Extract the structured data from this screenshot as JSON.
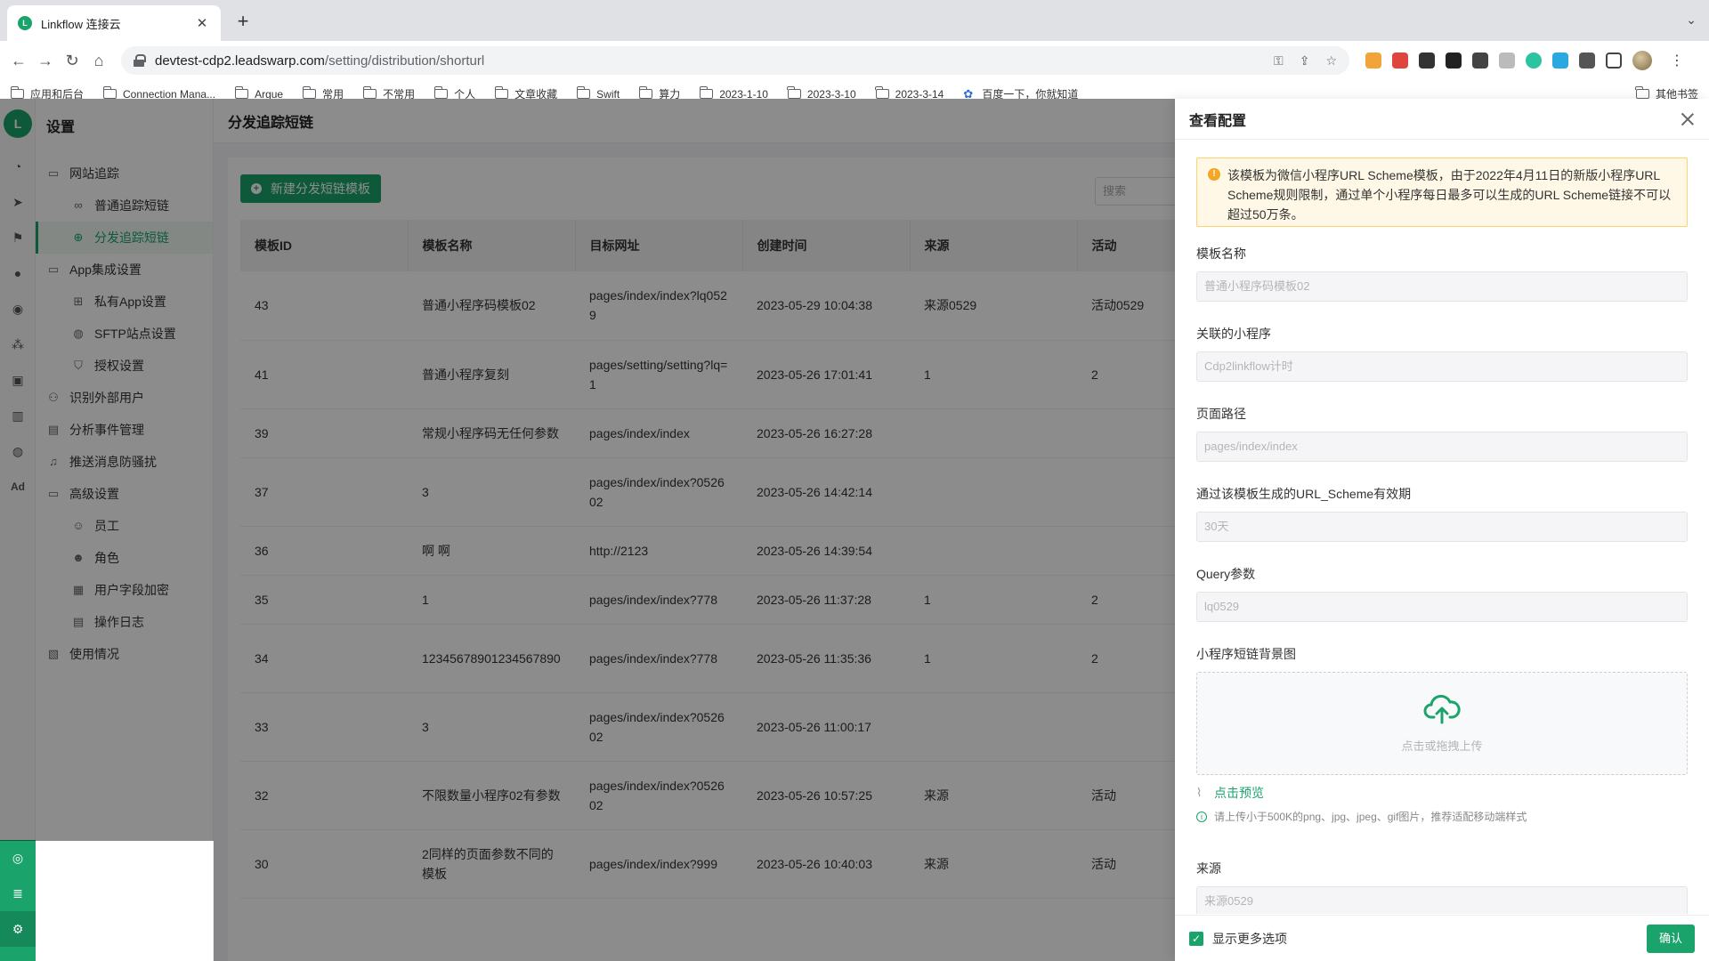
{
  "browser": {
    "tab_title": "Linkflow 连接云",
    "url_host": "devtest-cdp2.leadswarp.com",
    "url_path": "/setting/distribution/shorturl",
    "bookmarks": [
      "应用和后台",
      "Connection Mana...",
      "Argue",
      "常用",
      "不常用",
      "个人",
      "文章收藏",
      "Swift",
      "算力",
      "2023-1-10",
      "2023-3-10",
      "2023-3-14"
    ],
    "bookmark_baidu": "百度一下，你就知道",
    "bookmark_other": "其他书签"
  },
  "nav": {
    "title": "设置",
    "items": [
      {
        "label": "网站追踪",
        "icon": "folder-icon",
        "level": 1
      },
      {
        "label": "普通追踪短链",
        "icon": "link-icon",
        "level": 2
      },
      {
        "label": "分发追踪短链",
        "icon": "target-icon",
        "level": 2,
        "active": true
      },
      {
        "label": "App集成设置",
        "icon": "folder-icon",
        "level": 1
      },
      {
        "label": "私有App设置",
        "icon": "apps-icon",
        "level": 2
      },
      {
        "label": "SFTP站点设置",
        "icon": "globe-icon",
        "level": 2
      },
      {
        "label": "授权设置",
        "icon": "shield-icon",
        "level": 2
      },
      {
        "label": "识别外部用户",
        "icon": "user-search-icon",
        "level": 1
      },
      {
        "label": "分析事件管理",
        "icon": "event-icon",
        "level": 1
      },
      {
        "label": "推送消息防骚扰",
        "icon": "bell-off-icon",
        "level": 1
      },
      {
        "label": "高级设置",
        "icon": "folder-icon",
        "level": 1
      },
      {
        "label": "员工",
        "icon": "user-icon",
        "level": 2
      },
      {
        "label": "角色",
        "icon": "role-icon",
        "level": 2
      },
      {
        "label": "用户字段加密",
        "icon": "encrypt-icon",
        "level": 2
      },
      {
        "label": "操作日志",
        "icon": "log-icon",
        "level": 2
      },
      {
        "label": "使用情况",
        "icon": "usage-icon",
        "level": 1
      }
    ]
  },
  "main": {
    "page_title": "分发追踪短链",
    "new_button": "新建分发短链模板",
    "search_placeholder": "搜索",
    "columns": [
      "模板ID",
      "模板名称",
      "目标网址",
      "创建时间",
      "来源",
      "活动"
    ],
    "rows": [
      [
        "43",
        "普通小程序码模板02",
        "pages/index/index?lq0529",
        "2023-05-29 10:04:38",
        "来源0529",
        "活动0529"
      ],
      [
        "41",
        "普通小程序复刻",
        "pages/setting/setting?lq=1",
        "2023-05-26 17:01:41",
        "1",
        "2"
      ],
      [
        "39",
        "常规小程序码无任何参数",
        "pages/index/index",
        "2023-05-26 16:27:28",
        "",
        ""
      ],
      [
        "37",
        "3",
        "pages/index/index?052602",
        "2023-05-26 14:42:14",
        "",
        ""
      ],
      [
        "36",
        "啊 啊",
        "http://2123",
        "2023-05-26 14:39:54",
        "",
        ""
      ],
      [
        "35",
        "1",
        "pages/index/index?778",
        "2023-05-26 11:37:28",
        "1",
        "2"
      ],
      [
        "34",
        "12345678901234567890",
        "pages/index/index?778",
        "2023-05-26 11:35:36",
        "1",
        "2"
      ],
      [
        "33",
        "3",
        "pages/index/index?052602",
        "2023-05-26 11:00:17",
        "",
        ""
      ],
      [
        "32",
        "不限数量小程序02有参数",
        "pages/index/index?052602",
        "2023-05-26 10:57:25",
        "来源",
        "活动"
      ],
      [
        "30",
        "2同样的页面参数不同的模板",
        "pages/index/index?999",
        "2023-05-26 10:40:03",
        "来源",
        "活动"
      ]
    ]
  },
  "drawer": {
    "title": "查看配置",
    "warning": "该模板为微信小程序URL Scheme模板，由于2022年4月11日的新版小程序URL Scheme规则限制，通过单个小程序每日最多可以生成的URL Scheme链接不可以超过50万条。",
    "fields": [
      {
        "label": "模板名称",
        "value": "普通小程序码模板02"
      },
      {
        "label": "关联的小程序",
        "value": "Cdp2linkflow计时"
      },
      {
        "label": "页面路径",
        "value": "pages/index/index"
      },
      {
        "label": "通过该模板生成的URL_Scheme有效期",
        "value": "30天"
      },
      {
        "label": "Query参数",
        "value": "lq0529"
      }
    ],
    "bg_label": "小程序短链背景图",
    "upload_hint": "点击或拖拽上传",
    "preview": "点击预览",
    "upload_tip": "请上传小于500K的png、jpg、jpeg、gif图片，推荐适配移动端样式",
    "source_label": "来源",
    "source_value": "来源0529",
    "show_more": "显示更多选项",
    "confirm": "确认"
  },
  "colors": {
    "brand": "#1aa36b",
    "warning_bg": "#fff8e6",
    "warning_border": "#ffd36b"
  }
}
